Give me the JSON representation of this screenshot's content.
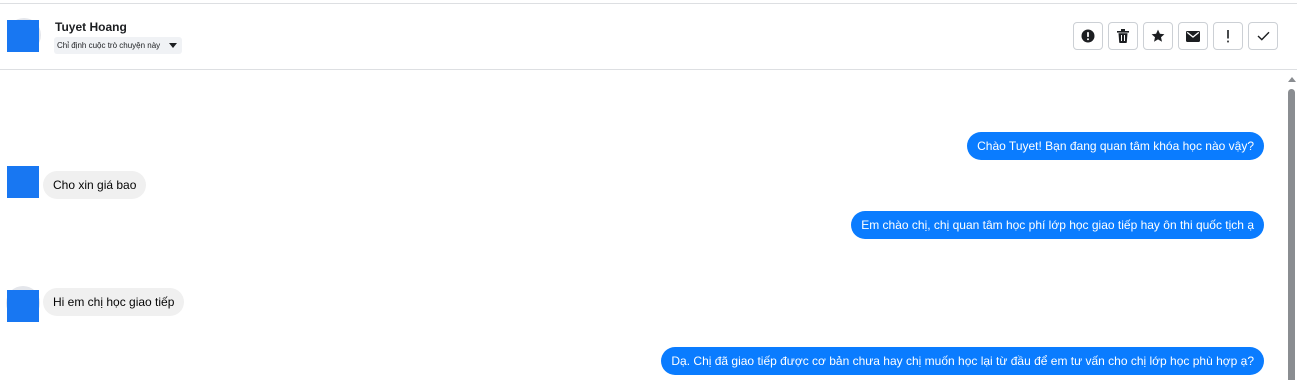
{
  "header": {
    "contact_name": "Tuyet Hoang",
    "assign_select": {
      "selected": "Chỉ định cuộc trò chuyện này"
    },
    "actions": [
      {
        "name": "mark-spam-button",
        "icon": "alert-circle-icon"
      },
      {
        "name": "delete-button",
        "icon": "trash-icon"
      },
      {
        "name": "star-button",
        "icon": "star-icon"
      },
      {
        "name": "mark-unread-button",
        "icon": "envelope-icon"
      },
      {
        "name": "follow-up-button",
        "icon": "exclamation-icon"
      },
      {
        "name": "mark-done-button",
        "icon": "checkmark-icon"
      }
    ]
  },
  "messages": [
    {
      "direction": "out",
      "text": "Chào Tuyet! Bạn đang quan tâm khóa học nào vậy?"
    },
    {
      "direction": "in",
      "text": "Cho xin giá bao"
    },
    {
      "direction": "out",
      "text": "Em chào chị, chị quan tâm học phí lớp học giao tiếp hay ôn thi quốc tịch ạ"
    },
    {
      "direction": "in",
      "text": "Hi em chị học giao tiếp"
    },
    {
      "direction": "out",
      "text": "Dạ. Chị đã giao tiếp được cơ bản chưa hay chị muốn học lại từ đầu để em tư vấn cho chị lớp học phù hợp ạ?"
    }
  ],
  "colors": {
    "outgoing_bubble": "#0a7cff",
    "incoming_bubble": "#f0f0f0",
    "avatar": "#1877f2",
    "divider": "#dddfe2"
  }
}
